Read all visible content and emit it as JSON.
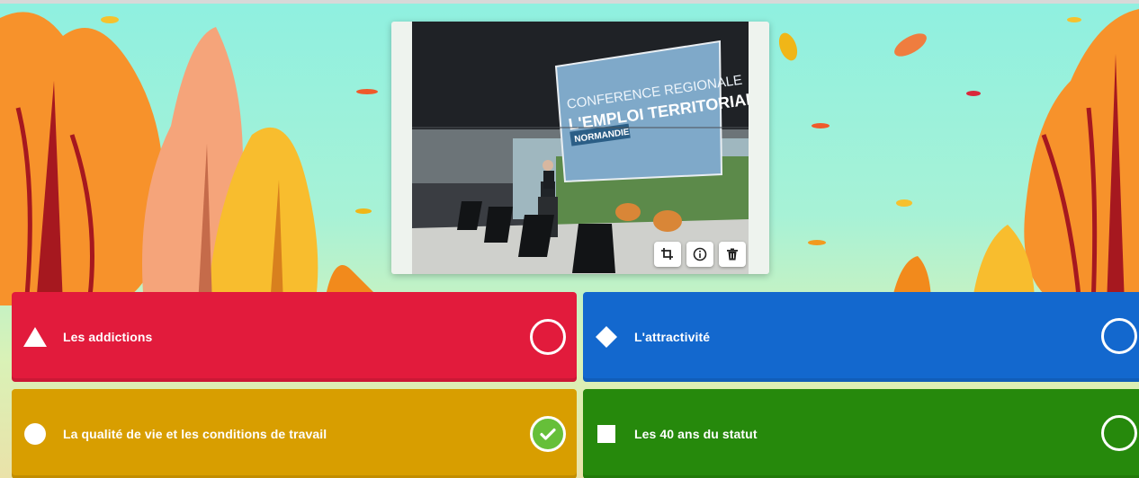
{
  "quiz": {
    "answers": [
      {
        "text": "Les addictions",
        "shape": "triangle-icon",
        "color": "#e21b3c",
        "correct": false
      },
      {
        "text": "L'attractivité",
        "shape": "diamond-icon",
        "color": "#1368ce",
        "correct": false
      },
      {
        "text": "La qualité de vie et les conditions de travail",
        "shape": "circle-icon",
        "color": "#d89e00",
        "correct": true
      },
      {
        "text": "Les 40 ans du statut",
        "shape": "square-icon",
        "color": "#26890c",
        "correct": false
      }
    ],
    "media": {
      "screen_lines": [
        "CONFERENCE REGIONALE",
        "L'EMPLOI TERRITORIAL",
        "NORMANDIE"
      ],
      "toolbar": [
        "crop-icon",
        "info-icon",
        "delete-icon"
      ]
    }
  }
}
